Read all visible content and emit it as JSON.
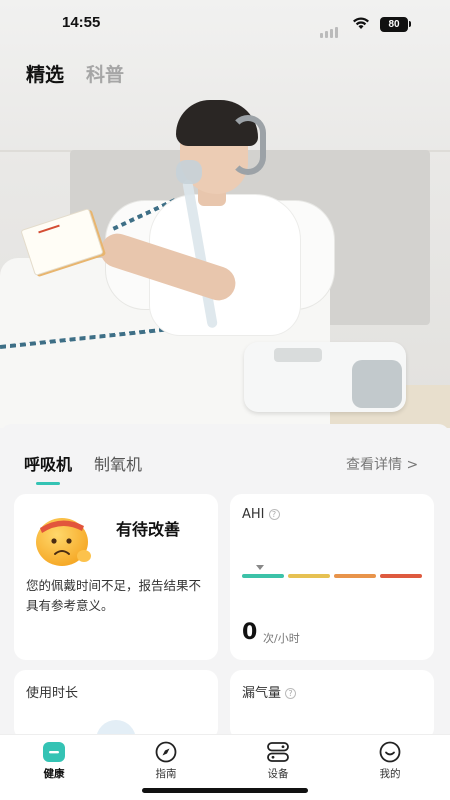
{
  "status_bar": {
    "time": "14:55",
    "battery": "80"
  },
  "top_tabs": [
    {
      "label": "精选",
      "active": true
    },
    {
      "label": "科普",
      "active": false
    }
  ],
  "device_tabs": [
    {
      "label": "呼吸机",
      "active": true
    },
    {
      "label": "制氧机",
      "active": false
    }
  ],
  "details_link": "查看详情 >",
  "status_card": {
    "title": "有待改善",
    "description": "您的佩戴时间不足，报告结果不具有参考意义。",
    "icon": "frowning-face-icon"
  },
  "ahi_card": {
    "title": "AHI",
    "value": "0",
    "unit": "次/小时",
    "scale_colors": [
      "#3cc2a8",
      "#e6c152",
      "#e8944b",
      "#de5a3f"
    ]
  },
  "usage_card": {
    "title": "使用时长"
  },
  "leak_card": {
    "title": "漏气量"
  },
  "bottom_nav": [
    {
      "label": "健康",
      "icon": "health-icon",
      "active": true
    },
    {
      "label": "指南",
      "icon": "compass-icon",
      "active": false
    },
    {
      "label": "设备",
      "icon": "device-icon",
      "active": false
    },
    {
      "label": "我的",
      "icon": "smile-icon",
      "active": false
    }
  ],
  "colors": {
    "accent": "#34c3b4",
    "background": "#f4f4f5"
  }
}
